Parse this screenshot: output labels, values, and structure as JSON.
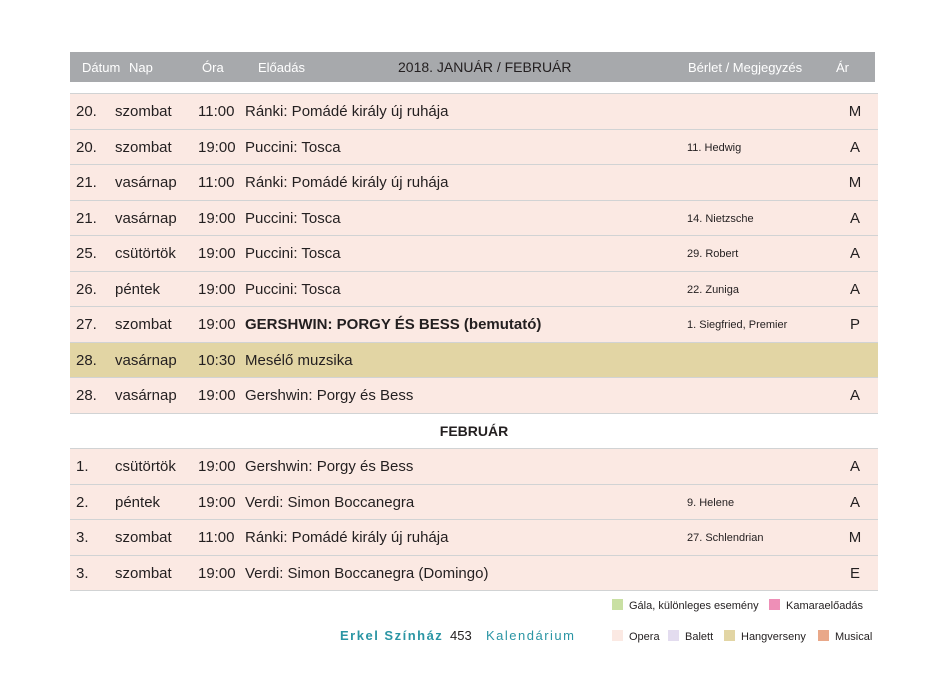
{
  "header": {
    "date": "Dátum",
    "day": "Nap",
    "time": "Óra",
    "performance": "Előadás",
    "title": "2018. JANUÁR / FEBRUÁR",
    "note": "Bérlet / Megjegyzés",
    "price": "Ár"
  },
  "january_rows": [
    {
      "date": "20.",
      "day": "szombat",
      "time": "11:00",
      "title": "Ránki: Pomádé király új ruhája",
      "note": "",
      "price": "M"
    },
    {
      "date": "20.",
      "day": "szombat",
      "time": "19:00",
      "title": "Puccini: Tosca",
      "note": "11. Hedwig",
      "price": "A"
    },
    {
      "date": "21.",
      "day": "vasárnap",
      "time": "11:00",
      "title": "Ránki: Pomádé király új ruhája",
      "note": "",
      "price": "M"
    },
    {
      "date": "21.",
      "day": "vasárnap",
      "time": "19:00",
      "title": "Puccini: Tosca",
      "note": "14. Nietzsche",
      "price": "A"
    },
    {
      "date": "25.",
      "day": "csütörtök",
      "time": "19:00",
      "title": "Puccini: Tosca",
      "note": "29. Robert",
      "price": "A"
    },
    {
      "date": "26.",
      "day": "péntek",
      "time": "19:00",
      "title": "Puccini: Tosca",
      "note": "22. Zuniga",
      "price": "A"
    },
    {
      "date": "27.",
      "day": "szombat",
      "time": "19:00",
      "title": "GERSHWIN: PORGY ÉS BESS (bemutató)",
      "note": "1. Siegfried, Premier",
      "price": "P"
    },
    {
      "date": "28.",
      "day": "vasárnap",
      "time": "10:30",
      "title": "Mesélő muzsika",
      "note": "",
      "price": ""
    },
    {
      "date": "28.",
      "day": "vasárnap",
      "time": "19:00",
      "title": "Gershwin: Porgy és Bess",
      "note": "",
      "price": "A"
    }
  ],
  "section": "FEBRUÁR",
  "february_rows": [
    {
      "date": "1.",
      "day": "csütörtök",
      "time": "19:00",
      "title": "Gershwin: Porgy és Bess",
      "note": "",
      "price": "A"
    },
    {
      "date": "2.",
      "day": "péntek",
      "time": "19:00",
      "title": "Verdi: Simon Boccanegra",
      "note": "9. Helene",
      "price": "A"
    },
    {
      "date": "3.",
      "day": "szombat",
      "time": "11:00",
      "title": "Ránki: Pomádé király új ruhája",
      "note": "27. Schlendrian",
      "price": "M"
    },
    {
      "date": "3.",
      "day": "szombat",
      "time": "19:00",
      "title": "Verdi: Simon Boccanegra (Domingo)",
      "note": "",
      "price": "E"
    }
  ],
  "legend": {
    "gala": {
      "label": "Gála, különleges esemény",
      "color": "#c9e0a3"
    },
    "chamber": {
      "label": "Kamaraelőadás",
      "color": "#ee8fb7"
    },
    "opera": {
      "label": "Opera",
      "color": "#fbe9e3"
    },
    "ballet": {
      "label": "Balett",
      "color": "#e3dcef"
    },
    "concert": {
      "label": "Hangverseny",
      "color": "#e2d5a4"
    },
    "musical": {
      "label": "Musical",
      "color": "#e9a889"
    }
  },
  "footer": {
    "venue": "Erkel Színház",
    "page": "453",
    "calendar": "Kalendárium"
  }
}
